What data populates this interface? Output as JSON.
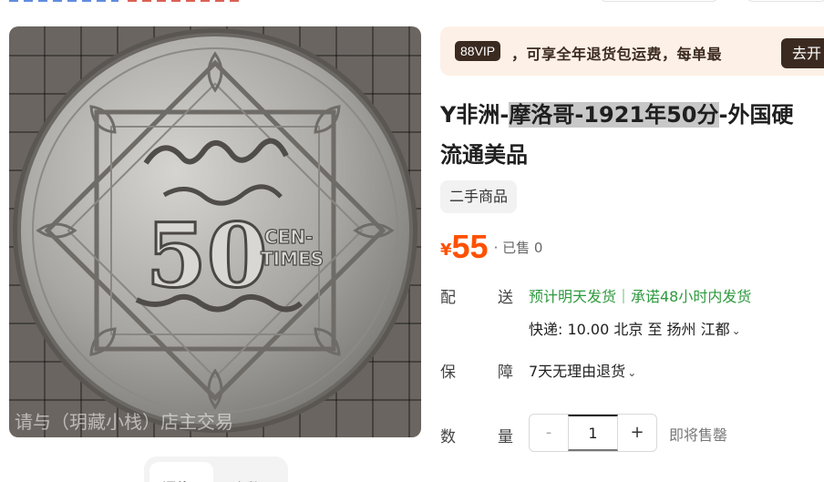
{
  "promo": {
    "badge": "88VIP",
    "text": "，可享全年退货包运费，每单最",
    "cta": "去开"
  },
  "product": {
    "title_prefix": "Y非洲-",
    "title_highlight": "摩洛哥-1921年50分",
    "title_suffix": "-外国硬",
    "title_line2": "流通美品",
    "tag": "二手商品",
    "currency": "¥",
    "price": "55",
    "sold": "· 已售 0",
    "image_watermark": "请与（玥藏小栈）店主交易",
    "coin": {
      "denomination": "50",
      "unit_top": "CEN-",
      "unit_bottom": "TIMES"
    }
  },
  "shipping": {
    "label_a": "配",
    "label_b": "送",
    "promise": "预计明天发货｜承诺48小时内发货",
    "detail": "快递: 10.00  北京  至  扬州 江都"
  },
  "guarantee": {
    "label_a": "保",
    "label_b": "障",
    "text": "7天无理由退货"
  },
  "quantity": {
    "label_a": "数",
    "label_b": "量",
    "minus": "-",
    "value": "1",
    "plus": "+",
    "status": "即将售罄"
  },
  "tabs": {
    "active": "评价",
    "other": "参数"
  },
  "colors": {
    "accent": "#ff5000",
    "promo_bg": "#fdf0e6",
    "promo_dark": "#3b2a20",
    "ship_green": "#2e9a3e"
  },
  "icons": {
    "chevron": "chevron-down-icon"
  }
}
